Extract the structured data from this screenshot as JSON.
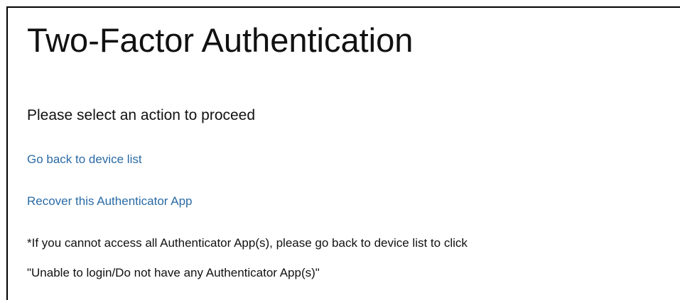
{
  "page": {
    "title": "Two-Factor Authentication",
    "subtitle": "Please select an action to proceed"
  },
  "actions": {
    "back_link": "Go back to device list",
    "recover_link": "Recover this Authenticator App"
  },
  "note": {
    "line1": "*If you cannot access all Authenticator App(s), please go back to device list to click",
    "line2": "\"Unable to login/Do not have any Authenticator App(s)\""
  },
  "colors": {
    "link": "#2a6ba5",
    "text": "#111111",
    "border": "#000000",
    "background": "#ffffff"
  }
}
